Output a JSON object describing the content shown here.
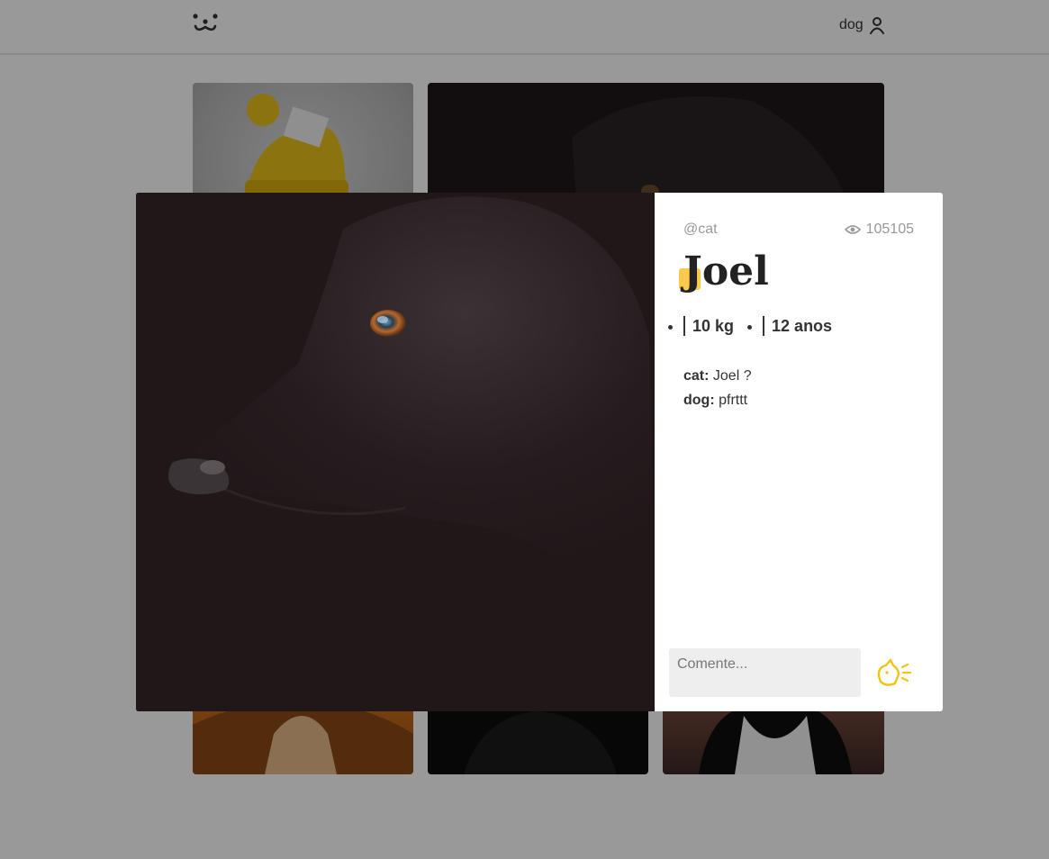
{
  "header": {
    "logo_icon": "dog-face-icon",
    "user_label": "dog",
    "user_icon": "user-icon"
  },
  "feed": {
    "tiles": [
      "photo-yellow-beanie-dog",
      "photo-black-dog",
      "photo-golden-dog",
      "photo-dark-dog",
      "photo-black-white-dog"
    ]
  },
  "modal": {
    "author": "@cat",
    "views_icon": "eye-icon",
    "views": "105105",
    "title": "Joel",
    "attributes": {
      "weight": "10 kg",
      "age": "12 anos"
    },
    "comments": [
      {
        "author": "cat:",
        "text": " Joel ?"
      },
      {
        "author": "dog:",
        "text": " pfrttt"
      }
    ],
    "comment_placeholder": "Comente...",
    "send_icon": "barking-dog-send-icon"
  },
  "colors": {
    "accent": "#fbc02d",
    "overlay": "rgba(0,0,0,0.4)",
    "photo_bg": "#1f1718",
    "input_bg": "#eeeeee"
  }
}
